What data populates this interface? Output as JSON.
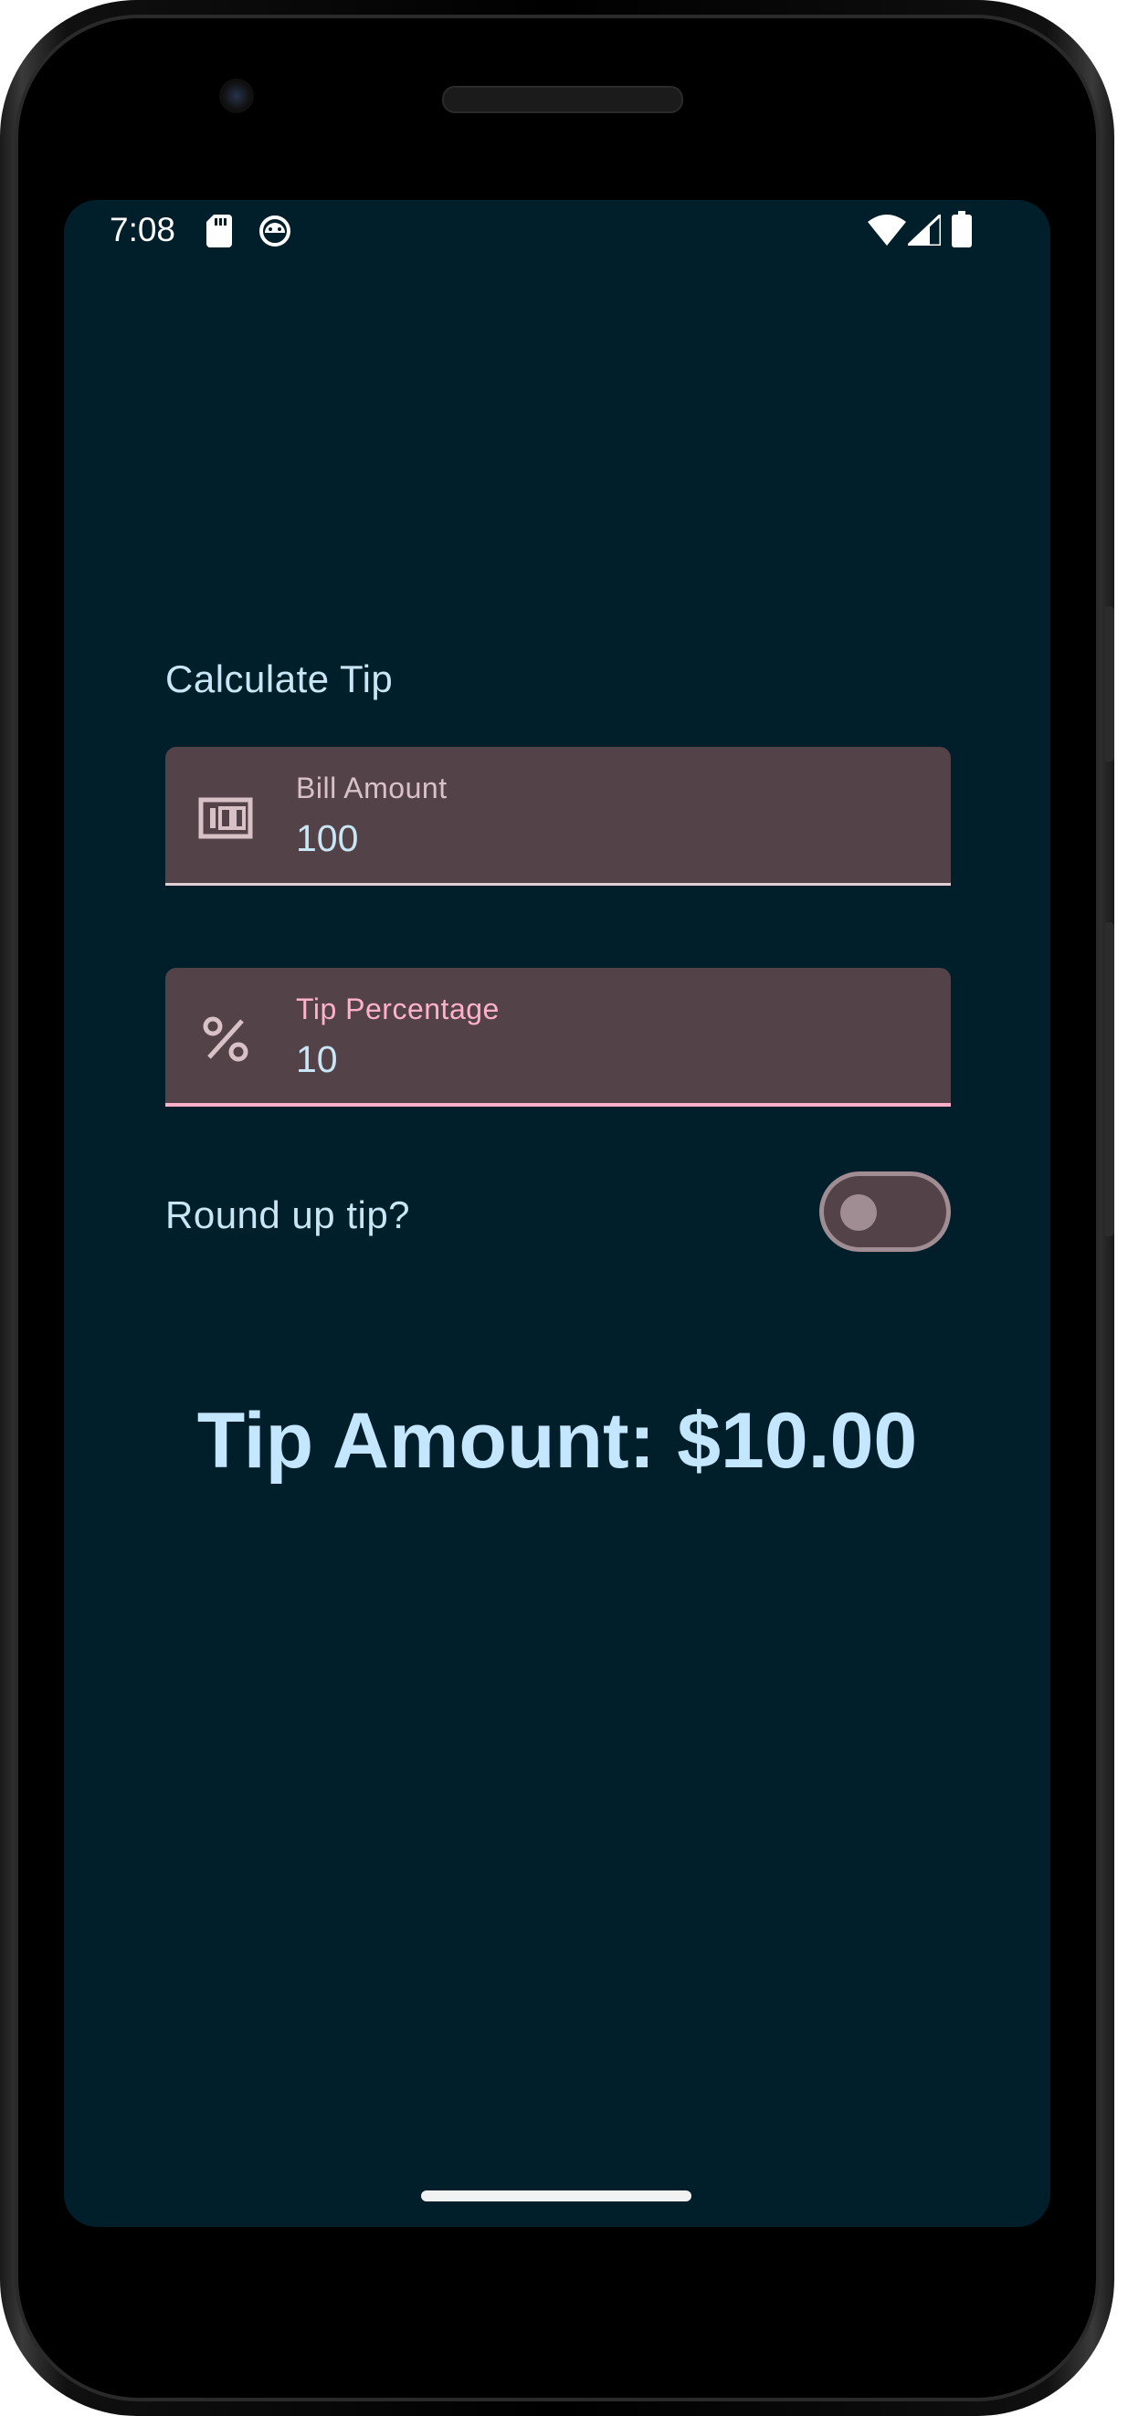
{
  "status_bar": {
    "time": "7:08",
    "left_icons": [
      "sd-card-icon",
      "android-debug-icon"
    ],
    "right_icons": [
      "wifi-icon",
      "signal-icon",
      "battery-icon"
    ]
  },
  "app": {
    "title": "Calculate Tip",
    "bill_amount": {
      "label": "Bill Amount",
      "value": "100",
      "icon": "money-icon"
    },
    "tip_percentage": {
      "label": "Tip Percentage",
      "value": "10",
      "icon": "percent-icon"
    },
    "round_up": {
      "label": "Round up tip?",
      "checked": false
    },
    "tip_amount_text": "Tip Amount: $10.00"
  },
  "colors": {
    "background": "#001f2a",
    "field_bg": "#534349",
    "primary_text": "#c8e6f5",
    "accent_pink": "#ffb0cb"
  }
}
